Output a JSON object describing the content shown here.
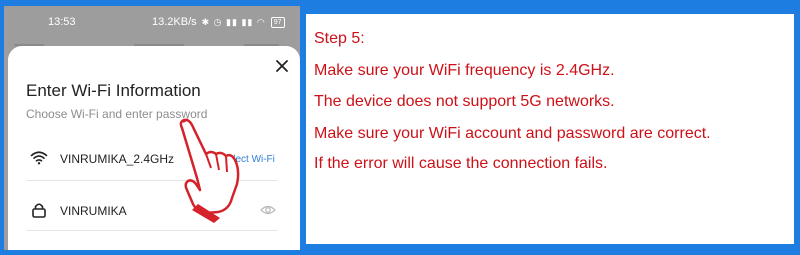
{
  "phone": {
    "status": {
      "time": "13:53",
      "speed": "13.2KB/s",
      "icons": "✱ ◷ ▮▮ ▮▮ ◠",
      "battery": "97"
    },
    "sheet": {
      "title": "Enter Wi-Fi Information",
      "subtitle": "Choose Wi-Fi and enter password",
      "wifi_name": "VINRUMIKA_2.4GHz",
      "select_wifi_label": "Select Wi-Fi",
      "password_value": "VINRUMIKA"
    }
  },
  "notes": {
    "step": "Step 5:",
    "lines": [
      "Make sure your WiFi frequency is 2.4GHz.",
      "The device does not support 5G networks.",
      "Make sure your WiFi account and password are correct.",
      "If the error will cause the connection fails."
    ]
  },
  "colors": {
    "frame_blue": "#1e7de0",
    "note_red": "#cc1118",
    "link_blue": "#2f7fd8",
    "hand_red": "#d4232a"
  }
}
